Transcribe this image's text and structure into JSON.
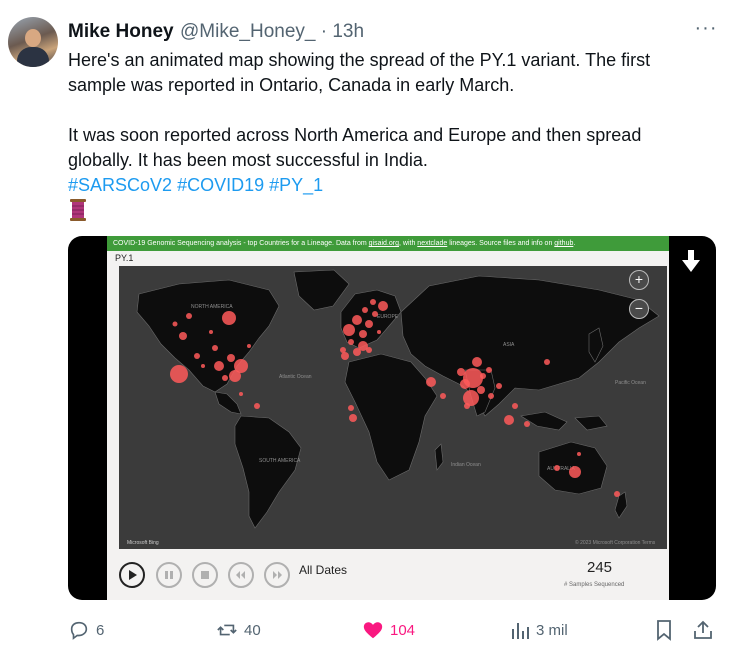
{
  "author": {
    "name": "Mike Honey",
    "handle": "@Mike_Honey_",
    "time": "13h"
  },
  "tweet": {
    "line1": "Here's an animated map showing the spread of the PY.1 variant. The first",
    "line2": "sample was reported in Ontario, Canada in early March.",
    "line3": "It was soon reported across North America and Europe and then spread",
    "line4": "globally. It has been most successful in India.",
    "hashtags": [
      "#SARSCoV2",
      "#COVID19",
      "#PY_1"
    ]
  },
  "media": {
    "banner_prefix": "COVID-19 Genomic Sequencing analysis - top Countries for a Lineage. Data from ",
    "banner_link1": "gisaid.org",
    "banner_mid1": ", with ",
    "banner_link2": "nextclade",
    "banner_mid2": " lineages. Source files and info on ",
    "banner_link3": "github",
    "banner_end": ".",
    "lineage": "PY.1",
    "map_labels": {
      "north_america": "NORTH AMERICA",
      "europe": "EUROPE",
      "asia": "ASIA",
      "south_america": "SOUTH AMERICA",
      "australia": "AUSTRALIA",
      "atlantic": "Atlantic Ocean",
      "pacific": "Pacific Ocean",
      "indian": "Indian Ocean",
      "brand": "Microsoft Bing",
      "copyright": "© 2023 Microsoft Corporation   Terms"
    },
    "date_filter": "All Dates",
    "samples_count": "245",
    "samples_label": "# Samples Sequenced"
  },
  "actions": {
    "replies": "6",
    "reposts": "40",
    "likes": "104",
    "views": "3 mil"
  },
  "colors": {
    "accent": "#1d9bf0",
    "like": "#f91880",
    "bubble": "#ff5a5a",
    "banner": "#3f9b3a"
  }
}
